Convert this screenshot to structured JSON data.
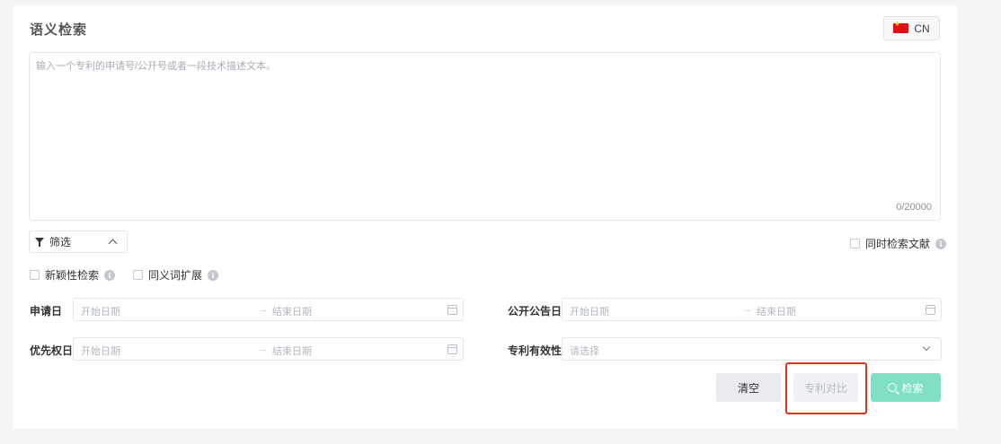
{
  "header": {
    "title": "语义检索",
    "language_label": "CN",
    "flag_icon": "china-flag-icon"
  },
  "query": {
    "placeholder": "输入一个专利的申请号/公开号或者一段技术描述文本。",
    "value": "",
    "counter": "0/20000"
  },
  "filter": {
    "label": "筛选",
    "icon": "funnel-icon",
    "expanded": true
  },
  "options": {
    "search_literature": "同时检索文献",
    "novelty_search": "新颖性检索",
    "synonym_expansion": "同义词扩展"
  },
  "fields": {
    "application_date": {
      "label": "申请日",
      "start_placeholder": "开始日期",
      "end_placeholder": "结束日期"
    },
    "publication_date": {
      "label": "公开公告日",
      "start_placeholder": "开始日期",
      "end_placeholder": "结束日期"
    },
    "priority_date": {
      "label": "优先权日",
      "start_placeholder": "开始日期",
      "end_placeholder": "结束日期"
    },
    "patent_validity": {
      "label": "专利有效性",
      "placeholder": "请选择"
    }
  },
  "actions": {
    "clear": "清空",
    "compare": "专利对比",
    "search": "检索"
  },
  "colors": {
    "accent": "#7fe0c3",
    "highlight": "#e0341f"
  }
}
